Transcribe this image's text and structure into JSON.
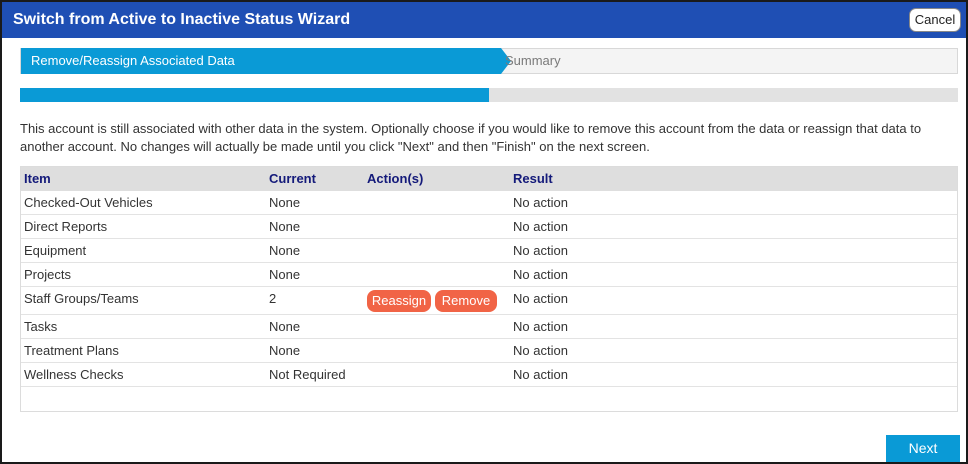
{
  "window": {
    "title": "Switch from Active to Inactive Status Wizard",
    "cancel_label": "Cancel"
  },
  "steps": [
    {
      "label": "Remove/Reassign Associated Data",
      "state": "active"
    },
    {
      "label": "Summary",
      "state": "pending"
    }
  ],
  "progress": {
    "percent": 50
  },
  "description": "This account is still associated with other data in the system. Optionally choose if you would like to remove this account from the data or reassign that data to another account. No changes will actually be made until you click \"Next\" and then \"Finish\" on the next screen.",
  "table": {
    "columns": [
      "Item",
      "Current",
      "Action(s)",
      "Result"
    ],
    "rows": [
      {
        "item": "Checked-Out Vehicles",
        "current": "None",
        "actions": [],
        "result": "No action"
      },
      {
        "item": "Direct Reports",
        "current": "None",
        "actions": [],
        "result": "No action"
      },
      {
        "item": "Equipment",
        "current": "None",
        "actions": [],
        "result": "No action"
      },
      {
        "item": "Projects",
        "current": "None",
        "actions": [],
        "result": "No action"
      },
      {
        "item": "Staff Groups/Teams",
        "current": "2",
        "actions": [
          "Reassign",
          "Remove"
        ],
        "result": "No action"
      },
      {
        "item": "Tasks",
        "current": "None",
        "actions": [],
        "result": "No action"
      },
      {
        "item": "Treatment Plans",
        "current": "None",
        "actions": [],
        "result": "No action"
      },
      {
        "item": "Wellness Checks",
        "current": "Not Required",
        "actions": [],
        "result": "No action"
      }
    ]
  },
  "footer": {
    "next_label": "Next"
  },
  "colors": {
    "titlebar": "#1f4fb4",
    "accent": "#0a9ad6",
    "action_button": "#f16446",
    "header_text": "#141a7a"
  }
}
